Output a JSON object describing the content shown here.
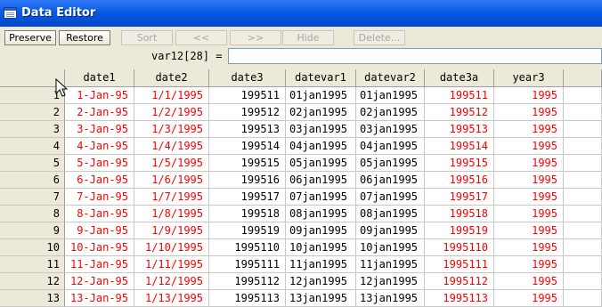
{
  "window": {
    "title": "Data Editor"
  },
  "toolbar": {
    "preserve": "Preserve",
    "restore": "Restore",
    "sort": "Sort",
    "prev": "<<",
    "next": ">>",
    "hide": "Hide",
    "delete": "Delete..."
  },
  "varbar": {
    "label": "var12[28]  =",
    "value": ""
  },
  "colors": {
    "string_text": "#ff0000",
    "numeric_text": "#000000",
    "titlebar": "#0a5ce6"
  },
  "columns": [
    "date1",
    "date2",
    "date3",
    "datevar1",
    "datevar2",
    "date3a",
    "year3"
  ],
  "rows": [
    {
      "n": "1",
      "c": [
        "1-Jan-95",
        "1/1/1995",
        "199511",
        "01jan1995",
        "01jan1995",
        "199511",
        "1995"
      ]
    },
    {
      "n": "2",
      "c": [
        "2-Jan-95",
        "1/2/1995",
        "199512",
        "02jan1995",
        "02jan1995",
        "199512",
        "1995"
      ]
    },
    {
      "n": "3",
      "c": [
        "3-Jan-95",
        "1/3/1995",
        "199513",
        "03jan1995",
        "03jan1995",
        "199513",
        "1995"
      ]
    },
    {
      "n": "4",
      "c": [
        "4-Jan-95",
        "1/4/1995",
        "199514",
        "04jan1995",
        "04jan1995",
        "199514",
        "1995"
      ]
    },
    {
      "n": "5",
      "c": [
        "5-Jan-95",
        "1/5/1995",
        "199515",
        "05jan1995",
        "05jan1995",
        "199515",
        "1995"
      ]
    },
    {
      "n": "6",
      "c": [
        "6-Jan-95",
        "1/6/1995",
        "199516",
        "06jan1995",
        "06jan1995",
        "199516",
        "1995"
      ]
    },
    {
      "n": "7",
      "c": [
        "7-Jan-95",
        "1/7/1995",
        "199517",
        "07jan1995",
        "07jan1995",
        "199517",
        "1995"
      ]
    },
    {
      "n": "8",
      "c": [
        "8-Jan-95",
        "1/8/1995",
        "199518",
        "08jan1995",
        "08jan1995",
        "199518",
        "1995"
      ]
    },
    {
      "n": "9",
      "c": [
        "9-Jan-95",
        "1/9/1995",
        "199519",
        "09jan1995",
        "09jan1995",
        "199519",
        "1995"
      ]
    },
    {
      "n": "10",
      "c": [
        "10-Jan-95",
        "1/10/1995",
        "1995110",
        "10jan1995",
        "10jan1995",
        "1995110",
        "1995"
      ]
    },
    {
      "n": "11",
      "c": [
        "11-Jan-95",
        "1/11/1995",
        "1995111",
        "11jan1995",
        "11jan1995",
        "1995111",
        "1995"
      ]
    },
    {
      "n": "12",
      "c": [
        "12-Jan-95",
        "1/12/1995",
        "1995112",
        "12jan1995",
        "12jan1995",
        "1995112",
        "1995"
      ]
    },
    {
      "n": "13",
      "c": [
        "13-Jan-95",
        "1/13/1995",
        "1995113",
        "13jan1995",
        "13jan1995",
        "1995113",
        "1995"
      ]
    }
  ]
}
